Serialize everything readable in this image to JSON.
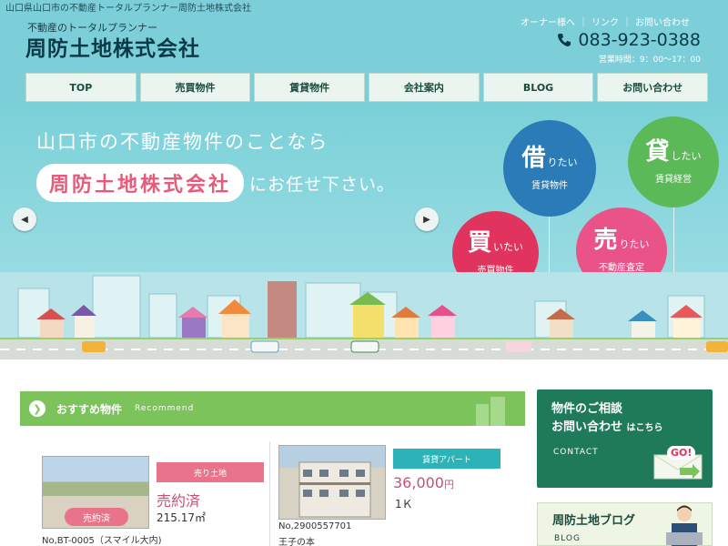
{
  "header": {
    "tagline": "山口県山口市の不動産トータルプランナー周防土地株式会社",
    "sublogo": "不動産のトータルプランナー",
    "logo": "周防土地株式会社",
    "links": [
      "オーナー様へ",
      "リンク",
      "お問い合わせ"
    ],
    "phone": "083-923-0388",
    "hours": "営業時間：9：00〜17：00"
  },
  "nav": [
    "TOP",
    "売買物件",
    "賃貸物件",
    "会社案内",
    "BLOG",
    "お問い合わせ"
  ],
  "hero": {
    "line1": "山口市の不動産物件のことなら",
    "company": "周防土地株式会社",
    "tail": "にお任せ下さい。",
    "balloons": [
      {
        "big": "借",
        "small": "りたい",
        "label": "賃貸物件",
        "color": "#2a7bb7"
      },
      {
        "big": "貸",
        "small": "したい",
        "label": "賃貸経営",
        "color": "#5bb957"
      },
      {
        "big": "買",
        "small": "いたい",
        "label": "売買物件",
        "color": "#e0335e"
      },
      {
        "big": "売",
        "small": "りたい",
        "label": "不動産査定",
        "color": "#e95388"
      }
    ]
  },
  "recommend": {
    "title": "おすすめ物件",
    "en": "Recommend"
  },
  "cards": [
    {
      "tag": "売り土地",
      "status_badge": "売約済",
      "price": "売約済",
      "area": "215.17㎡",
      "caption": "No,BT-0005（スマイル大内)"
    },
    {
      "tag": "賃貸アパート",
      "price": "36,000",
      "unit": "円",
      "layout": "1Ｋ",
      "id": "No,2900557701",
      "caption": "王子の本"
    }
  ],
  "contact": {
    "line1": "物件のご相談",
    "line2": "お問い合わせ",
    "line2_small": "はこちら",
    "en": "CONTACT",
    "go": "GO!"
  },
  "blog": {
    "title": "周防土地ブログ",
    "en": "BLOG"
  },
  "colors": {
    "teal": "#7ccfd8",
    "green": "#7cc35b",
    "pink": "#e8738a",
    "darkgreen": "#1f7a5a"
  }
}
